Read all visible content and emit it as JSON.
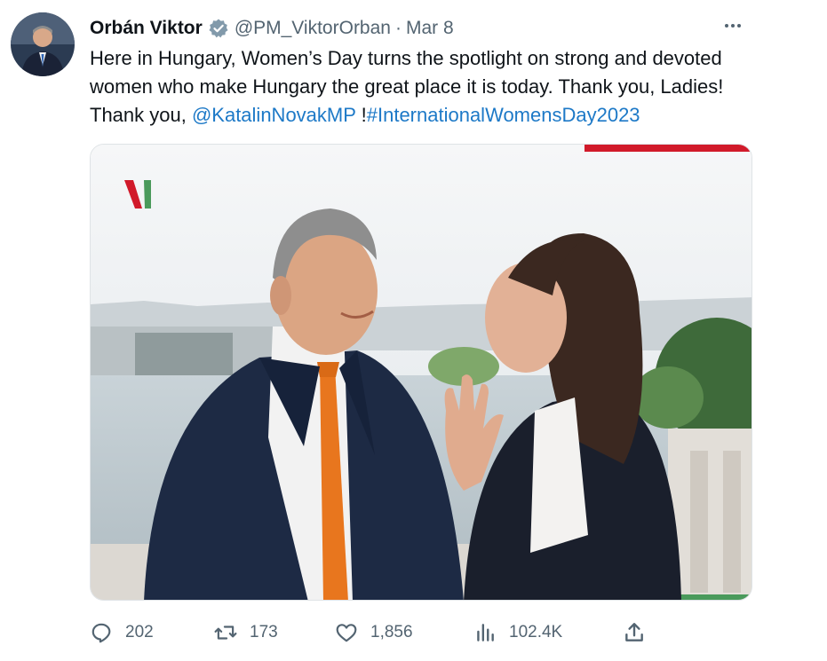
{
  "author": {
    "display_name": "Orbán Viktor",
    "handle": "@PM_ViktorOrban",
    "separator": "·",
    "date": "Mar 8",
    "verified_icon": "verified-badge-icon"
  },
  "tweet": {
    "line1": "Here in Hungary, Women’s Day turns the spotlight on strong and devoted",
    "line2": "women who make Hungary the great place it is today. Thank you, Ladies!",
    "line3_prefix": "Thank you, ",
    "mention": "@KatalinNovakMP",
    "line3_middle": " !",
    "hashtag": "#InternationalWomensDay2023"
  },
  "media": {
    "logo_icon": "hungarian-flag-logo-icon",
    "accent_colors": {
      "red": "#d11a2a",
      "green": "#4a9a5b",
      "tie": "#e8761e",
      "suit": "#1d2a44"
    }
  },
  "actions": {
    "reply_count": "202",
    "retweet_count": "173",
    "like_count": "1,856",
    "views_count": "102.4K"
  },
  "colors": {
    "text": "#0f1419",
    "secondary": "#536471",
    "link": "#1d79c7",
    "verified_gray": "#829aab"
  }
}
